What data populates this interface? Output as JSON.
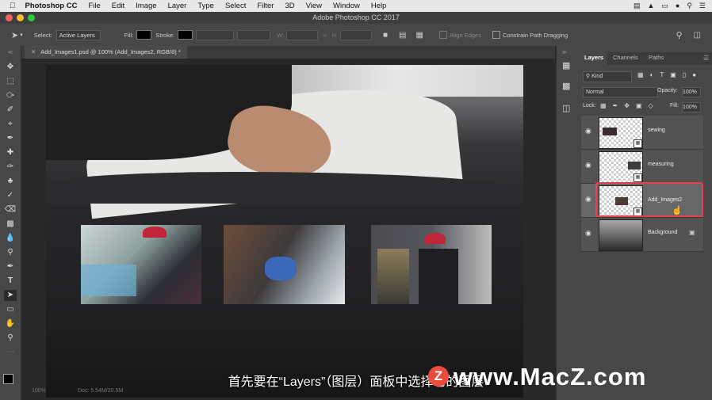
{
  "menubar": {
    "apple": "",
    "app": "Photoshop CC",
    "items": [
      "File",
      "Edit",
      "Image",
      "Layer",
      "Type",
      "Select",
      "Filter",
      "3D",
      "View",
      "Window",
      "Help"
    ]
  },
  "titlebar": {
    "title": "Adobe Photoshop CC 2017"
  },
  "options": {
    "select_label": "Select:",
    "select_value": "Active Layers",
    "fill_label": "Fill:",
    "stroke_label": "Stroke:",
    "w_label": "W:",
    "h_label": "H:",
    "align_edges": "Align Edges",
    "constrain": "Constrain Path Dragging"
  },
  "document": {
    "tab": "Add_Images1.psd @ 100% (Add_Images2, RGB/8) *"
  },
  "panel": {
    "tabs": [
      "Layers",
      "Channels",
      "Paths"
    ],
    "kind": "Kind",
    "blend": "Normal",
    "opacity_label": "Opacity:",
    "opacity": "100%",
    "lock_label": "Lock:",
    "fill_label": "Fill:",
    "fill": "100%",
    "layers": [
      {
        "name": "sewing"
      },
      {
        "name": "measuring"
      },
      {
        "name": "Add_Images2"
      },
      {
        "name": "Background"
      }
    ]
  },
  "status": {
    "zoom": "100%",
    "doc": "Doc: 5.54M/20.5M"
  },
  "subtitle": "首先要在“Layers”（图层）面板中选择它的图层",
  "watermark": {
    "logo": "Z",
    "text": "www.MacZ.com"
  },
  "colors": {
    "accent": "#e8414c",
    "panel": "#474747",
    "menubar": "#e8e8e8"
  }
}
